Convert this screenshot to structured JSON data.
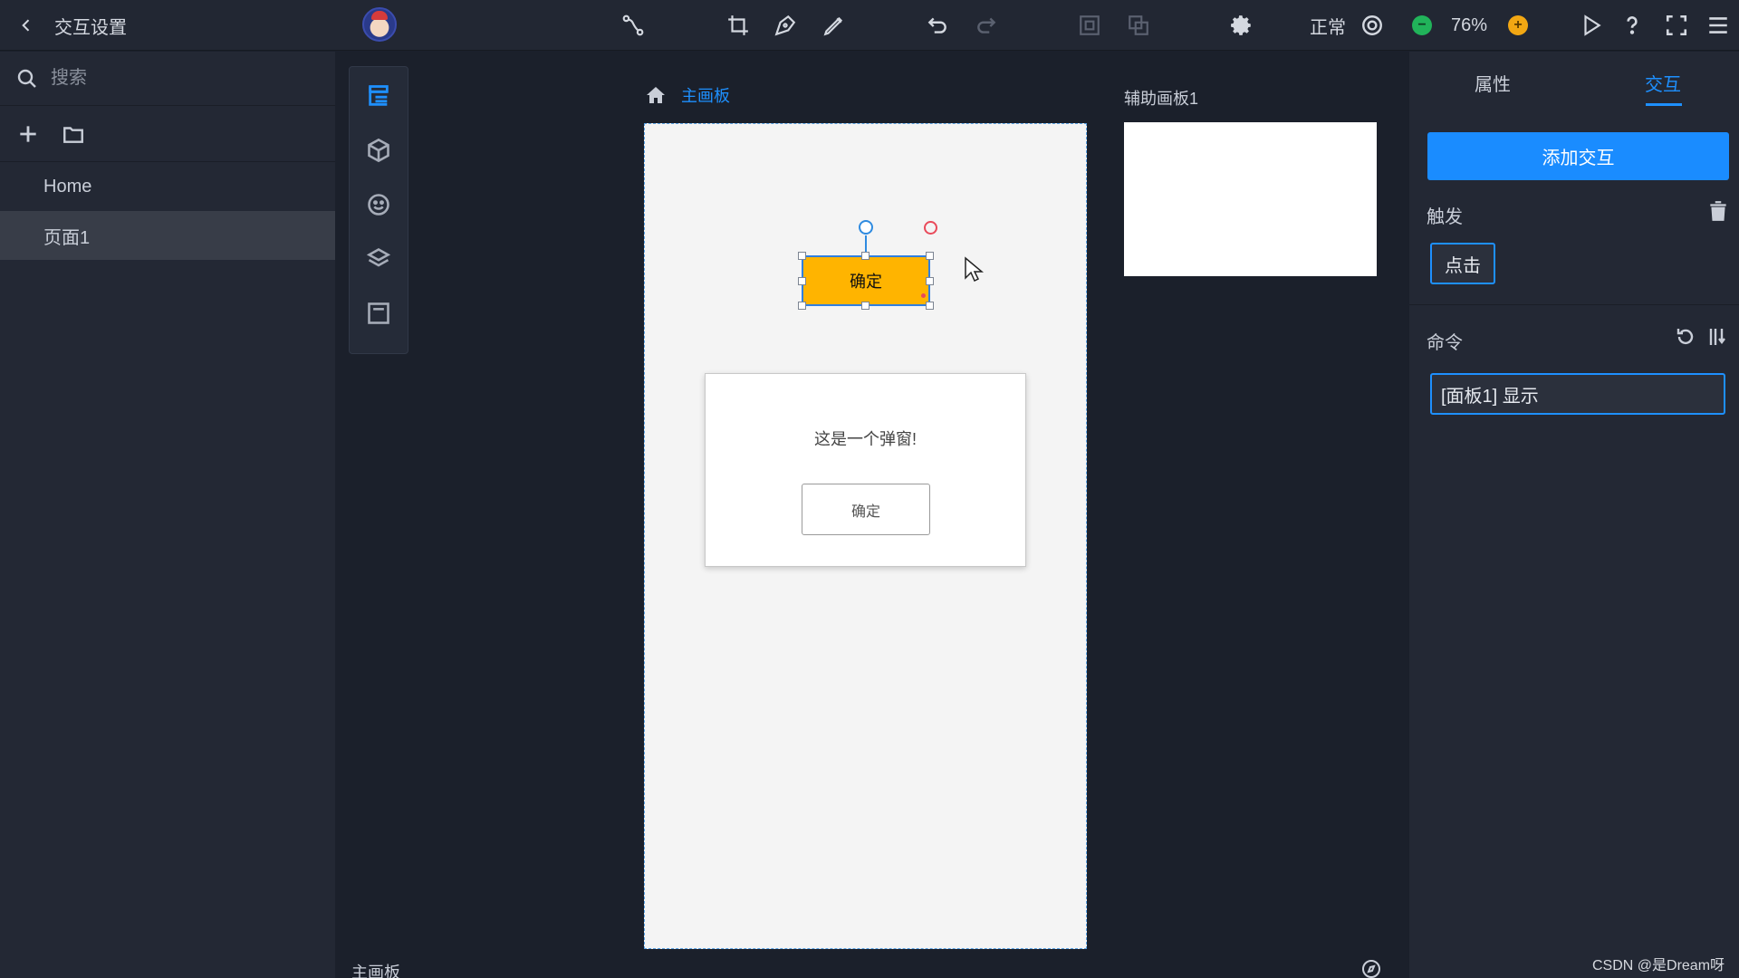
{
  "topbar": {
    "title": "交互设置",
    "mode_label": "正常",
    "zoom": "76%",
    "icons": [
      "back-icon",
      "avatar",
      "connector-icon",
      "crop-icon",
      "pen-icon",
      "pencil-icon",
      "undo-icon",
      "redo-icon",
      "frame-icon",
      "group-icon",
      "settings-icon",
      "preview-mode-icon",
      "zoom-out-icon",
      "zoom-in-icon",
      "play-icon",
      "help-icon",
      "fullscreen-icon",
      "menu-icon"
    ]
  },
  "sidebar": {
    "search_placeholder": "搜索",
    "pages": [
      {
        "label": "Home",
        "active": false
      },
      {
        "label": "页面1",
        "active": true
      }
    ]
  },
  "vtoolbar": {
    "icons": [
      "page-tree-icon",
      "component-icon",
      "emoji-icon",
      "layers-icon",
      "panel-icon"
    ],
    "active_index": 0
  },
  "canvas": {
    "board_title": "主画板",
    "aux_board_title": "辅助画板1",
    "selected_button_label": "确定",
    "popup_text": "这是一个弹窗!",
    "popup_button_label": "确定"
  },
  "bottom": {
    "board_label": "主画板"
  },
  "rightpanel": {
    "tabs": [
      {
        "label": "属性",
        "active": false
      },
      {
        "label": "交互",
        "active": true
      }
    ],
    "add_button": "添加交互",
    "trigger_label": "触发",
    "trigger_value": "点击",
    "command_label": "命令",
    "command_value": "[面板1] 显示"
  },
  "watermark": "CSDN @是Dream呀",
  "colors": {
    "accent": "#1e90ff",
    "selected_button": "#ffb400",
    "zoom_out": "#21b35a",
    "zoom_in": "#f2a713"
  }
}
